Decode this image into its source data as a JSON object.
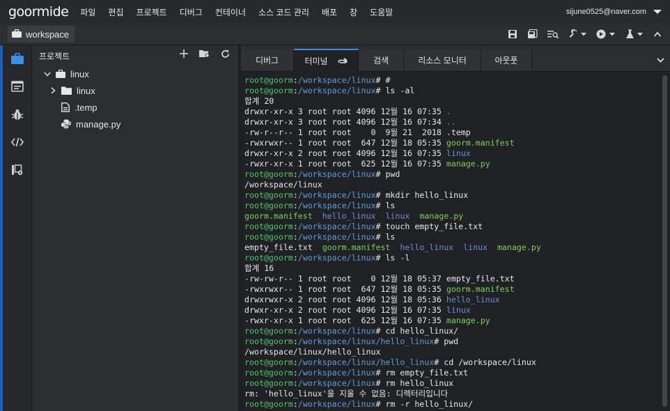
{
  "app": {
    "logo": "goormide",
    "menu": [
      "파일",
      "편집",
      "프로젝트",
      "디버그",
      "컨테이너",
      "소스 코드 관리",
      "배포",
      "창",
      "도움말"
    ],
    "user": "sijune0525@naver.com"
  },
  "workspace_tab": "workspace",
  "toolbar_icons": [
    "save-icon",
    "save-all-icon",
    "find-icon",
    "wrench-icon",
    "run-icon",
    "flask-icon",
    "collapse-icon"
  ],
  "sidebar_icons": [
    "project-icon",
    "terminal-window-icon",
    "debug-icon",
    "code-icon",
    "settings-icon"
  ],
  "explorer": {
    "title": "프로젝트",
    "tree": [
      {
        "label": "linux",
        "type": "root"
      },
      {
        "label": "linux",
        "type": "folder"
      },
      {
        "label": ".temp",
        "type": "file"
      },
      {
        "label": "manage.py",
        "type": "python"
      }
    ]
  },
  "tabs": [
    {
      "label": "디버그"
    },
    {
      "label": "터미널"
    },
    {
      "label": "검색"
    },
    {
      "label": "리소스 모니터"
    },
    {
      "label": "아웃풋"
    }
  ],
  "terminal": {
    "lines": [
      [
        [
          "u",
          "root@goorm"
        ],
        [
          "n",
          ":"
        ],
        [
          "p",
          "/workspace/linux"
        ],
        [
          "n",
          "# #"
        ]
      ],
      [
        [
          "u",
          "root@goorm"
        ],
        [
          "n",
          ":"
        ],
        [
          "p",
          "/workspace/linux"
        ],
        [
          "n",
          "# ls -al"
        ]
      ],
      [
        [
          "n",
          "합계 20"
        ]
      ],
      [
        [
          "n",
          "drwxr-xr-x 3 root root 4096 12월 16 07:35 "
        ],
        [
          "d",
          "."
        ]
      ],
      [
        [
          "n",
          "drwxr-xr-x 3 root root 4096 12월 16 07:34 "
        ],
        [
          "d",
          ".."
        ]
      ],
      [
        [
          "n",
          "-rw-r--r-- 1 root root    0  9월 21  2018 .temp"
        ]
      ],
      [
        [
          "n",
          "-rwxrwxr-- 1 root root  647 12월 18 05:35 "
        ],
        [
          "g",
          "goorm.manifest"
        ]
      ],
      [
        [
          "n",
          "drwxr-xr-x 2 root root 4096 12월 16 07:35 "
        ],
        [
          "d",
          "linux"
        ]
      ],
      [
        [
          "n",
          "-rwxr-xr-x 1 root root  625 12월 16 07:35 "
        ],
        [
          "g",
          "manage.py"
        ]
      ],
      [
        [
          "u",
          "root@goorm"
        ],
        [
          "n",
          ":"
        ],
        [
          "p",
          "/workspace/linux"
        ],
        [
          "n",
          "# pwd"
        ]
      ],
      [
        [
          "n",
          "/workspace/linux"
        ]
      ],
      [
        [
          "u",
          "root@goorm"
        ],
        [
          "n",
          ":"
        ],
        [
          "p",
          "/workspace/linux"
        ],
        [
          "n",
          "# mkdir hello_linux"
        ]
      ],
      [
        [
          "u",
          "root@goorm"
        ],
        [
          "n",
          ":"
        ],
        [
          "p",
          "/workspace/linux"
        ],
        [
          "n",
          "# ls"
        ]
      ],
      [
        [
          "g",
          "goorm.manifest"
        ],
        [
          "n",
          "  "
        ],
        [
          "d",
          "hello_linux"
        ],
        [
          "n",
          "  "
        ],
        [
          "d",
          "linux"
        ],
        [
          "n",
          "  "
        ],
        [
          "g",
          "manage.py"
        ]
      ],
      [
        [
          "u",
          "root@goorm"
        ],
        [
          "n",
          ":"
        ],
        [
          "p",
          "/workspace/linux"
        ],
        [
          "n",
          "# touch empty_file.txt"
        ]
      ],
      [
        [
          "u",
          "root@goorm"
        ],
        [
          "n",
          ":"
        ],
        [
          "p",
          "/workspace/linux"
        ],
        [
          "n",
          "# ls"
        ]
      ],
      [
        [
          "n",
          "empty_file.txt  "
        ],
        [
          "g",
          "goorm.manifest"
        ],
        [
          "n",
          "  "
        ],
        [
          "d",
          "hello_linux"
        ],
        [
          "n",
          "  "
        ],
        [
          "d",
          "linux"
        ],
        [
          "n",
          "  "
        ],
        [
          "g",
          "manage.py"
        ]
      ],
      [
        [
          "u",
          "root@goorm"
        ],
        [
          "n",
          ":"
        ],
        [
          "p",
          "/workspace/linux"
        ],
        [
          "n",
          "# ls -l"
        ]
      ],
      [
        [
          "n",
          "합계 16"
        ]
      ],
      [
        [
          "n",
          "-rw-rw-r-- 1 root root    0 12월 18 05:37 empty_file.txt"
        ]
      ],
      [
        [
          "n",
          "-rwxrwxr-- 1 root root  647 12월 18 05:35 "
        ],
        [
          "g",
          "goorm.manifest"
        ]
      ],
      [
        [
          "n",
          "drwxrwxr-x 2 root root 4096 12월 18 05:36 "
        ],
        [
          "d",
          "hello_linux"
        ]
      ],
      [
        [
          "n",
          "drwxr-xr-x 2 root root 4096 12월 16 07:35 "
        ],
        [
          "d",
          "linux"
        ]
      ],
      [
        [
          "n",
          "-rwxr-xr-x 1 root root  625 12월 16 07:35 "
        ],
        [
          "g",
          "manage.py"
        ]
      ],
      [
        [
          "u",
          "root@goorm"
        ],
        [
          "n",
          ":"
        ],
        [
          "p",
          "/workspace/linux"
        ],
        [
          "n",
          "# cd hello_linux/"
        ]
      ],
      [
        [
          "u",
          "root@goorm"
        ],
        [
          "n",
          ":"
        ],
        [
          "p",
          "/workspace/linux/hello_linux"
        ],
        [
          "n",
          "# pwd"
        ]
      ],
      [
        [
          "n",
          "/workspace/linux/hello_linux"
        ]
      ],
      [
        [
          "u",
          "root@goorm"
        ],
        [
          "n",
          ":"
        ],
        [
          "p",
          "/workspace/linux/hello_linux"
        ],
        [
          "n",
          "# cd /workspace/linux"
        ]
      ],
      [
        [
          "u",
          "root@goorm"
        ],
        [
          "n",
          ":"
        ],
        [
          "p",
          "/workspace/linux"
        ],
        [
          "n",
          "# rm empty_file.txt"
        ]
      ],
      [
        [
          "u",
          "root@goorm"
        ],
        [
          "n",
          ":"
        ],
        [
          "p",
          "/workspace/linux"
        ],
        [
          "n",
          "# rm hello_linux"
        ]
      ],
      [
        [
          "n",
          "rm: 'hello_linux'을 지울 수 없음: 디렉터리입니다"
        ]
      ],
      [
        [
          "u",
          "root@goorm"
        ],
        [
          "n",
          ":"
        ],
        [
          "p",
          "/workspace/linux"
        ],
        [
          "n",
          "# rm -r hello_linux/"
        ]
      ]
    ]
  },
  "colors": {
    "accent": "#3b8fe8",
    "prompt_user": "#4fc76a",
    "prompt_path": "#5f9dd9",
    "exec_file": "#7fd05a",
    "dir": "#6b8fd6"
  }
}
